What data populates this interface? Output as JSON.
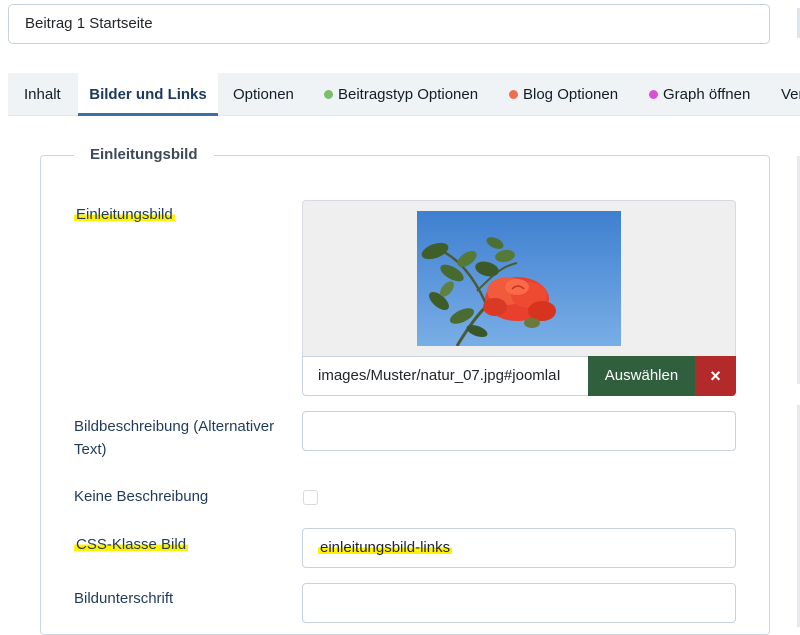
{
  "title_field": {
    "value": "Beitrag 1 Startseite"
  },
  "tabs": [
    {
      "label": "Inhalt"
    },
    {
      "label": "Bilder und Links",
      "active": true
    },
    {
      "label": "Optionen"
    },
    {
      "label": "Beitragstyp Optionen",
      "dot_color": "#7bbf6a"
    },
    {
      "label": "Blog Optionen",
      "dot_color": "#f26d4f"
    },
    {
      "label": "Graph öffnen",
      "dot_color": "#d94fd6"
    },
    {
      "label": "Ver"
    }
  ],
  "fieldset": {
    "legend": "Einleitungsbild",
    "image_field": {
      "label": "Einleitungsbild",
      "path": "images/Muster/natur_07.jpg#joomlaI",
      "select_label": "Auswählen",
      "clear_icon": "×"
    },
    "alt_text": {
      "label_line1": "Bildbeschreibung (Alternativer",
      "label_line2": "Text)",
      "value": ""
    },
    "no_description": {
      "label": "Keine Beschreibung",
      "checked": false
    },
    "css_class": {
      "label": "CSS-Klasse Bild",
      "value": "einleitungsbild-links"
    },
    "caption": {
      "label": "Bildunterschrift",
      "value": ""
    }
  },
  "colors": {
    "highlight": "#fff200",
    "select_button": "#2f5f3d",
    "clear_button": "#b22a2a",
    "active_tab_underline": "#3f6fa7"
  }
}
